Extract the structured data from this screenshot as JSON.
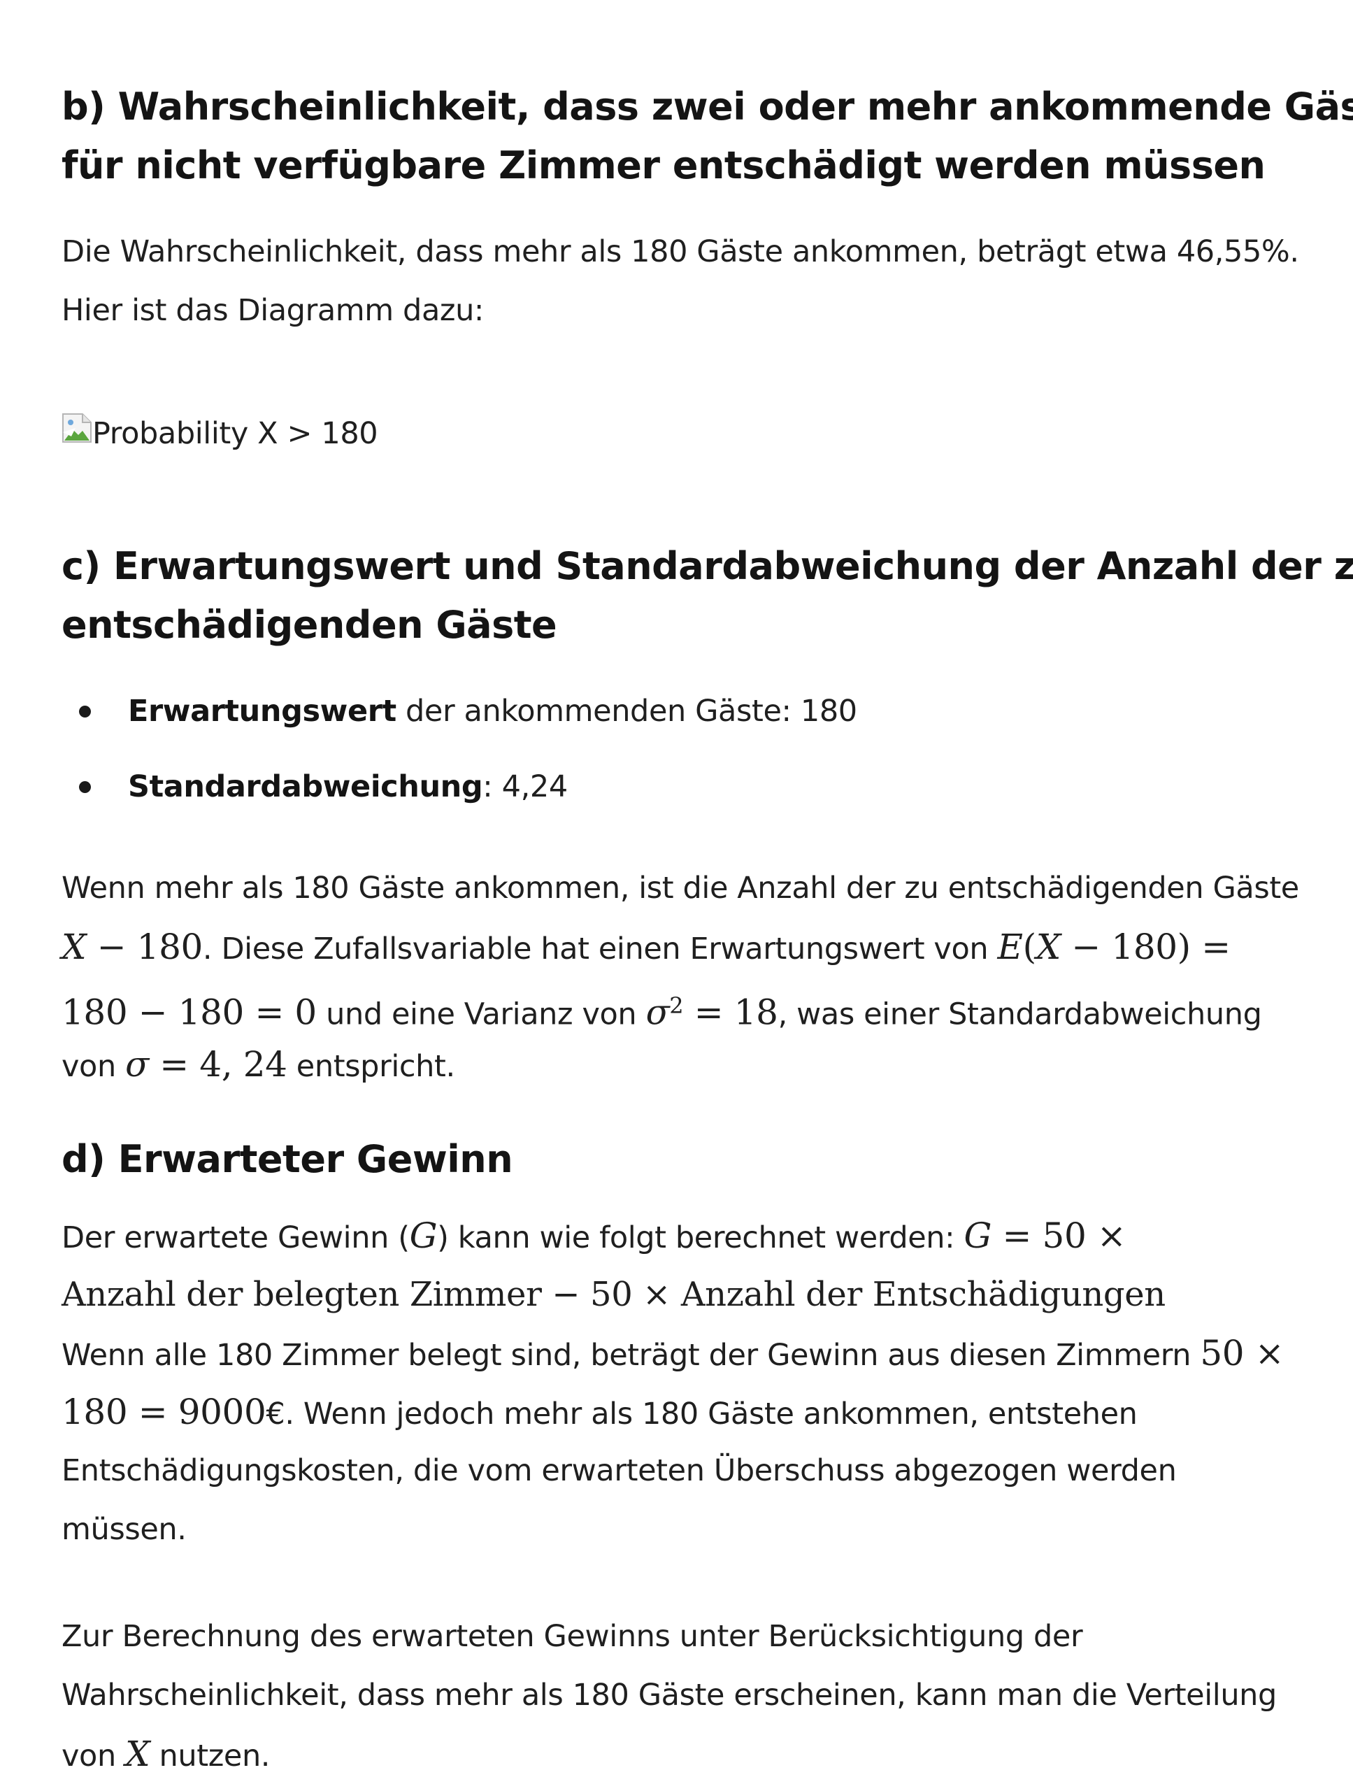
{
  "section_b": {
    "heading_line1": "b) Wahrscheinlichkeit, dass zwei oder mehr ankommende Gäste",
    "heading_line2": "für nicht verfügbare Zimmer entschädigt werden müssen",
    "para_line1": "Die Wahrscheinlichkeit, dass mehr als 180 Gäste ankommen, beträgt etwa 46,55%.",
    "para_line2": "Hier ist das Diagramm dazu:",
    "image_alt": "Probability X > 180"
  },
  "section_c": {
    "heading_line1": "c) Erwartungswert und Standardabweichung der Anzahl der zu",
    "heading_line2": "entschädigenden Gäste",
    "bullets": [
      {
        "bold": "Erwartungswert",
        "rest": " der ankommenden Gäste: 180"
      },
      {
        "bold": "Standardabweichung",
        "rest": ": 4,24"
      }
    ],
    "para": {
      "l1": "Wenn mehr als 180 Gäste ankommen, ist die Anzahl der zu entschädigenden Gäste",
      "l2_math_a": "X",
      "l2_math_b": " − 180",
      "l2_text": ". Diese Zufallsvariable hat einen Erwartungswert von ",
      "l2_math_c": "E",
      "l2_math_d": "(",
      "l2_math_e": "X",
      "l2_math_f": " − 180) =",
      "l3_math_a": "180 − 180 = 0",
      "l3_text": " und eine Varianz von ",
      "l3_math_b": "σ",
      "l3_sup": "2",
      "l3_math_c": " = 18",
      "l3_text2": ", was einer Standardabweichung",
      "l4_text": "von ",
      "l4_math_a": "σ",
      "l4_math_b": " = 4, 24",
      "l4_text2": " entspricht."
    }
  },
  "section_d": {
    "heading": "d) Erwarteter Gewinn",
    "para1": {
      "l1_text": "Der erwartete Gewinn (",
      "l1_math_a": "G",
      "l1_text2": ") kann wie folgt berechnet werden: ",
      "l1_math_b": "G",
      "l1_math_c": " = 50 ×",
      "l2_math": "Anzahl der belegten Zimmer − 50 × Anzahl der Entschädigungen",
      "l3_text": "Wenn alle 180 Zimmer belegt sind, beträgt der Gewinn aus diesen Zimmern ",
      "l3_math": "50 ×",
      "l4_math": "180 = 9000",
      "l4_text": "€. Wenn jedoch mehr als 180 Gäste ankommen, entstehen",
      "l5_text": "Entschädigungskosten, die vom erwarteten Überschuss abgezogen werden",
      "l6_text": "müssen."
    },
    "para2": {
      "l1_text": "Zur Berechnung des erwarteten Gewinns unter Berücksichtigung der",
      "l2_text": "Wahrscheinlichkeit, dass mehr als 180 Gäste erscheinen, kann man die Verteilung",
      "l3_text": "von ",
      "l3_math": "X",
      "l3_text2": " nutzen."
    }
  }
}
